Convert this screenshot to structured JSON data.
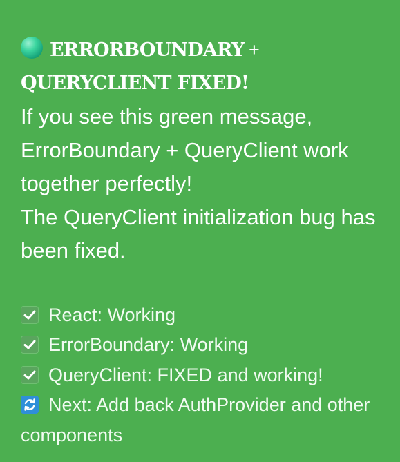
{
  "message": {
    "title_main": "ERRORBOUNDARY",
    "title_plus": " + ",
    "title_second": "QUERYCLIENT FIXED!",
    "body_line_1": "If you see this green message, ErrorBoundary + QueryClient work together perfectly!",
    "body_line_2": "The QueryClient initialization bug has been fixed."
  },
  "status": {
    "items": [
      {
        "icon": "check-icon",
        "text": "React: Working"
      },
      {
        "icon": "check-icon",
        "text": "ErrorBoundary: Working"
      },
      {
        "icon": "check-icon",
        "text": "QueryClient: FIXED and working!"
      },
      {
        "icon": "refresh-icon",
        "text": "Next: Add back AuthProvider and other components"
      }
    ]
  },
  "colors": {
    "background": "#4caf50",
    "text": "#ffffff",
    "check_icon": "#5aa55e",
    "refresh_icon": "#2f8fd8",
    "status_dot": "#3dd6a0"
  }
}
